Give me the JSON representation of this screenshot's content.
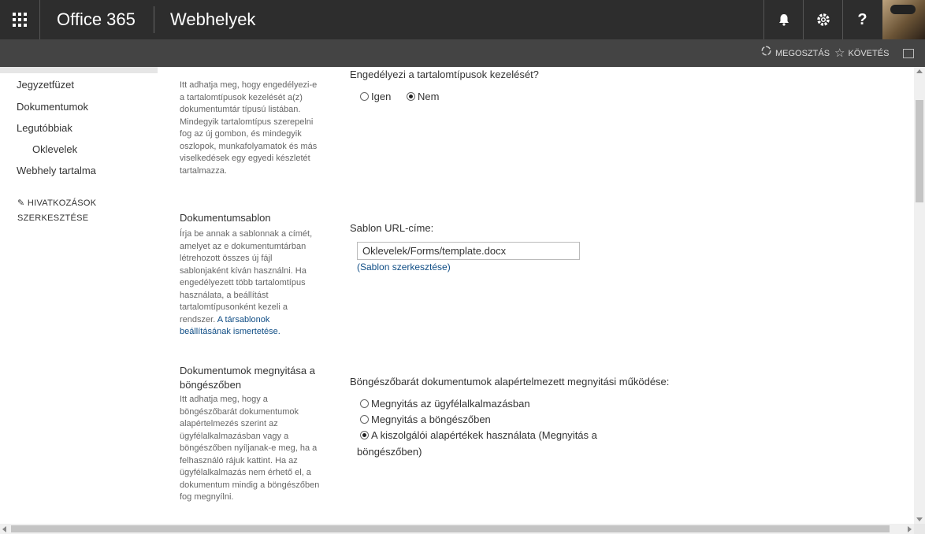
{
  "suitebar": {
    "brand": "Office 365",
    "site_title": "Webhelyek",
    "icons": [
      "app-launcher-icon",
      "bell-icon",
      "gear-icon",
      "help-icon"
    ],
    "help_glyph": "?"
  },
  "actionbar": {
    "share_label": "MEGOSZTÁS",
    "follow_label": "KÖVETÉS",
    "icons": [
      "share-icon",
      "star-icon",
      "focus-icon"
    ]
  },
  "leftnav": {
    "items": [
      {
        "label": "Jegyzetfüzet"
      },
      {
        "label": "Dokumentumok"
      },
      {
        "label": "Legutóbbiak"
      },
      {
        "label": "Oklevelek"
      },
      {
        "label": "Webhely tartalma"
      }
    ],
    "edit_links_line1": "HIVATKOZÁSOK",
    "edit_links_line2": "SZERKESZTÉSE"
  },
  "sections": {
    "content_types": {
      "desc": "Itt adhatja meg, hogy engedélyezi-e a tartalomtípusok kezelését a(z) dokumentumtár típusú listában. Mindegyik tartalomtípus szerepelni fog az új gombon, és mindegyik oszlopok, munkafolyamatok és más viselkedések egy egyedi készletét tartalmazza.",
      "question": "Engedélyezi a tartalomtípusok kezelését?",
      "option_yes": "Igen",
      "option_no": "Nem"
    },
    "template": {
      "title": "Dokumentumsablon",
      "desc": "Írja be annak a sablonnak a címét, amelyet az e dokumentumtárban létrehozott összes új fájl sablonjaként kíván használni. Ha engedélyezett több tartalomtípus használata, a beállítást tartalomtípusonként kezeli a rendszer. ",
      "desc_link": "A társablonok beállításának ismertetése.",
      "url_label": "Sablon URL-címe:",
      "url_value": "Oklevelek/Forms/template.docx",
      "edit_link": "(Sablon szerkesztése)"
    },
    "browser": {
      "title": "Dokumentumok megnyitása a böngészőben",
      "desc": "Itt adhatja meg, hogy a böngészőbarát dokumentumok alapértelmezés szerint az ügyfélalkalmazásban vagy a böngészőben nyíljanak-e meg, ha a felhasználó rájuk kattint. Ha az ügyfélalkalmazás nem érhető el, a dokumentum mindig a böngészőben fog megnyílni.",
      "question": "Böngészőbarát dokumentumok alapértelmezett megnyitási működése:",
      "option_client": "Megnyitás az ügyfélalkalmazásban",
      "option_browser": "Megnyitás a böngészőben",
      "option_default_line1": "A kiszolgálói alapértékek használata (Megnyitás a",
      "option_default_line2": "böngészőben)"
    }
  },
  "colors": {
    "suitebar_bg": "#2d2d2d",
    "actionbar_bg": "#444444",
    "link": "#0f4d85"
  }
}
